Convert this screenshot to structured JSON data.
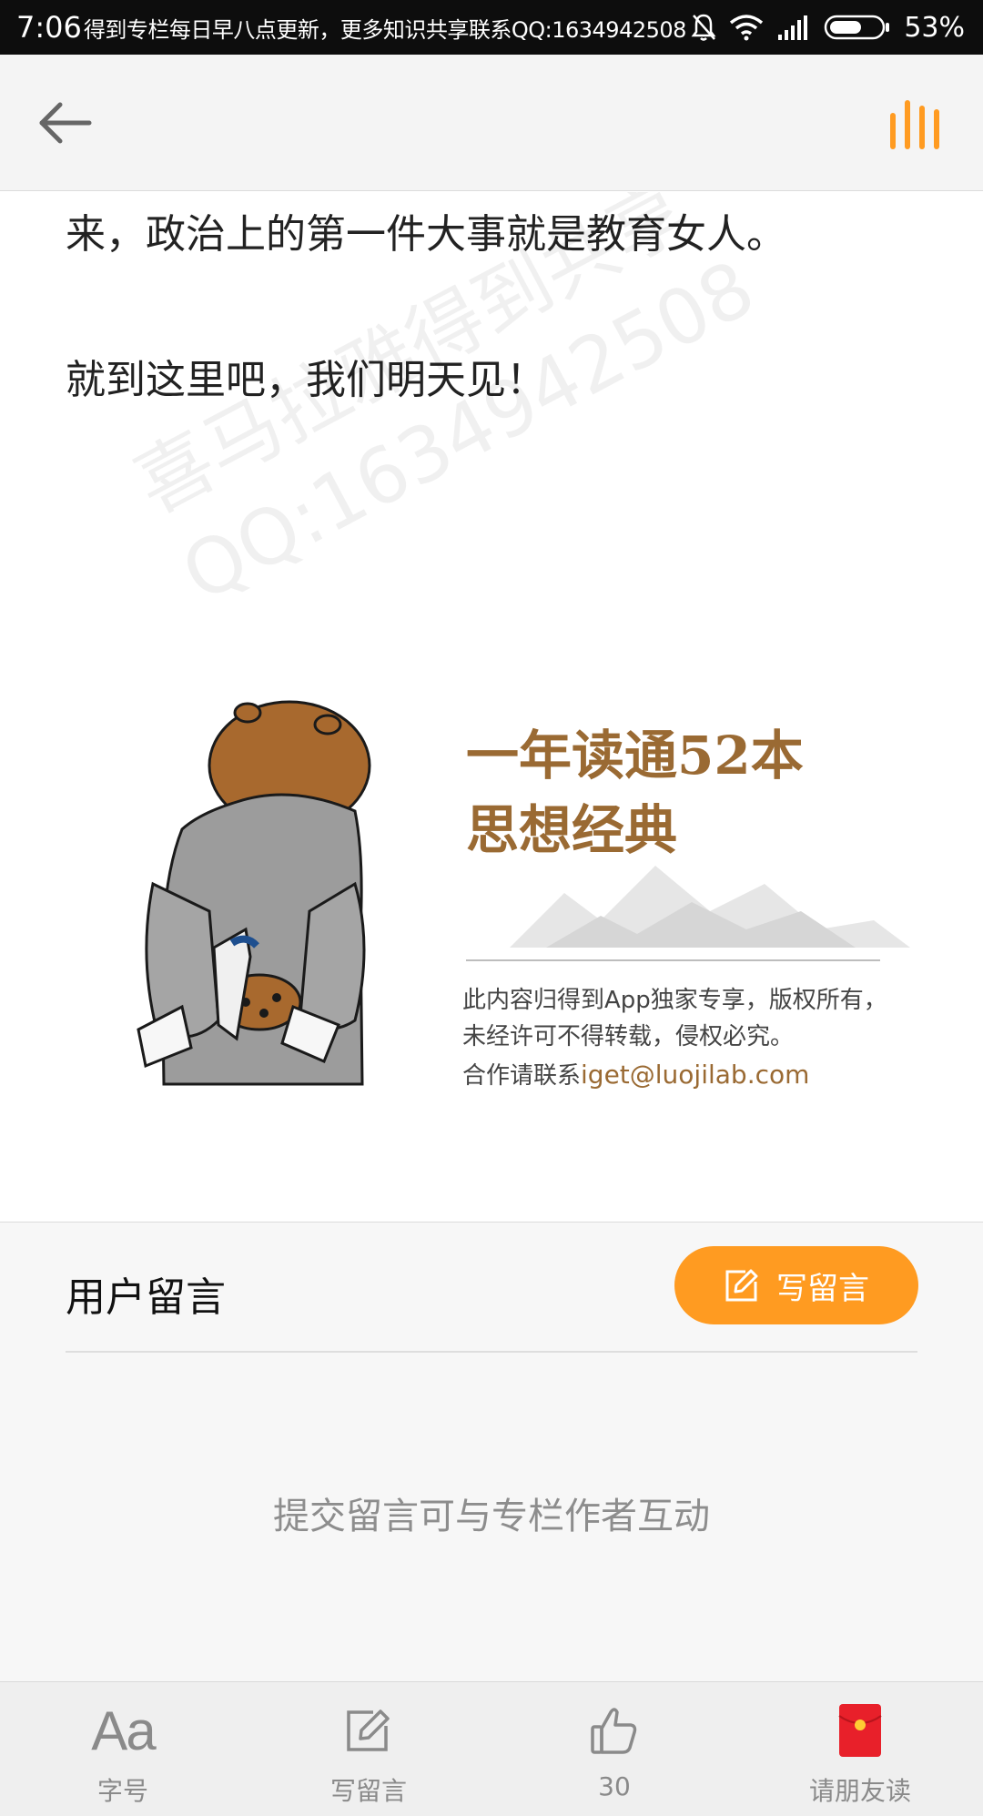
{
  "status_bar": {
    "time": "7:06",
    "notice": "得到专栏每日早八点更新，更多知识共享联系QQ:1634942508",
    "battery": "53%"
  },
  "nav": {
    "back_icon": "arrow-left-icon",
    "audio_icon": "audio-bars-icon",
    "accent_color": "#ff9b21"
  },
  "article": {
    "paragraphs": [
      "来，政治上的第一件大事就是教育女人。",
      "就到这里吧，我们明天见！"
    ],
    "watermark_lines": [
      "喜马拉雅得到共享",
      "QQ:1634942508"
    ],
    "promo": {
      "title_line_1": "一年读通52本",
      "title_line_2": "思想经典",
      "notice": "此内容归得到App独家专享，版权所有，未经许可不得转载，侵权必究。",
      "contact_label": "合作请联系",
      "contact_email": "iget@luojilab.com"
    }
  },
  "comments": {
    "title": "用户留言",
    "write_button_label": "写留言",
    "hint": "提交留言可与专栏作者互动"
  },
  "toolbar": {
    "font_icon_text": "Aa",
    "font_label": "字号",
    "write_label": "写留言",
    "like_count": "30",
    "share_label": "请朋友读"
  }
}
